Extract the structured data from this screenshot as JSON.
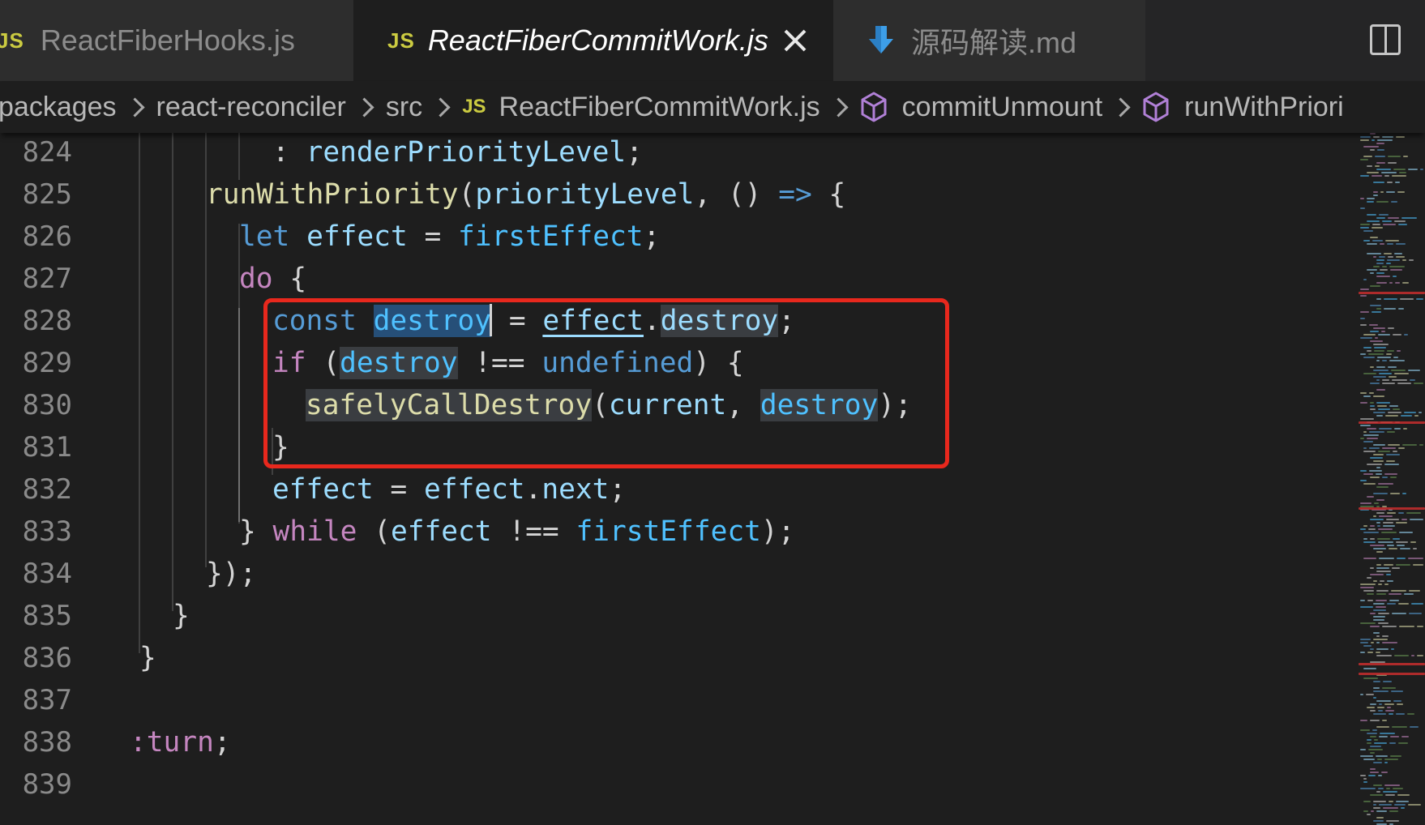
{
  "tabs": [
    {
      "badge": "JS",
      "name": "ReactFiberHooks.js",
      "active": false
    },
    {
      "badge": "JS",
      "name": "ReactFiberCommitWork.js",
      "active": true,
      "close_icon": "close-icon"
    },
    {
      "icon": "markdown-download-icon",
      "name": "源码解读.md",
      "active": false
    }
  ],
  "toolbar": {
    "split_icon": "split-editor-icon"
  },
  "breadcrumb": {
    "items": [
      "packages",
      "react-reconciler",
      "src",
      "ReactFiberCommitWork.js",
      "commitUnmount",
      "runWithPriori"
    ],
    "js_badge": "JS",
    "symbol_icon": "cube-icon"
  },
  "code": {
    "line_numbers": [
      "824",
      "825",
      "826",
      "827",
      "828",
      "829",
      "830",
      "831",
      "832",
      "833",
      "834",
      "835",
      "836",
      "837",
      "838",
      "839"
    ],
    "lines": [
      {
        "parts": [
          ": ",
          "renderPriorityLevel",
          ";"
        ]
      },
      {
        "parts": [
          "runWithPriority",
          "(",
          "priorityLevel",
          ", () ",
          "=>",
          " {"
        ]
      },
      {
        "parts": [
          "let",
          " ",
          "effect",
          " = ",
          "firstEffect",
          ";"
        ]
      },
      {
        "parts": [
          "do",
          " {"
        ]
      },
      {
        "parts": [
          "const",
          " ",
          "destroy",
          " = ",
          "effect",
          ".",
          "destroy",
          ";"
        ]
      },
      {
        "parts": [
          "if",
          " (",
          "destroy",
          " !== ",
          "undefined",
          ") {"
        ]
      },
      {
        "parts": [
          "safelyCallDestroy",
          "(",
          "current",
          ", ",
          "destroy",
          ");"
        ]
      },
      {
        "parts": [
          "}"
        ]
      },
      {
        "parts": [
          "effect",
          " = ",
          "effect",
          ".",
          "next",
          ";"
        ]
      },
      {
        "parts": [
          "} ",
          "while",
          " (",
          "effect",
          " !== ",
          "firstEffect",
          ");"
        ]
      },
      {
        "parts": [
          "});"
        ]
      },
      {
        "parts": [
          "}"
        ]
      },
      {
        "parts": [
          "}"
        ]
      },
      {
        "parts": [
          ""
        ]
      },
      {
        "parts": [
          ":turn",
          ";"
        ]
      },
      {
        "parts": [
          ""
        ]
      }
    ]
  },
  "colors": {
    "background": "#1e1e1e",
    "tab_inactive": "#2d2d2d",
    "js_badge": "#cbcb41",
    "keyword": "#569cd6",
    "control": "#c586c0",
    "function": "#dcdcaa",
    "variable": "#9cdcfe",
    "constant": "#4fc1ff",
    "annotation_box": "#e8281d"
  }
}
